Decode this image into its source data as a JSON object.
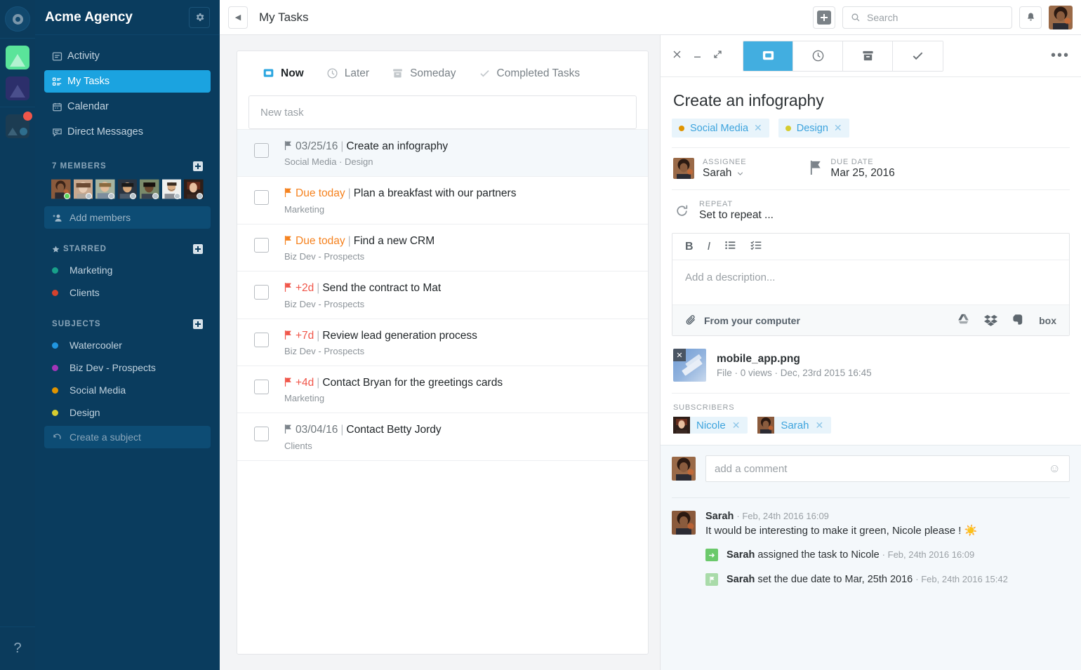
{
  "rail": {
    "logo_icon": "circle-logo-icon",
    "apps": [
      {
        "name": "workspace-green",
        "icon": "triangle-icon"
      },
      {
        "name": "workspace-navy",
        "icon": "triangle-icon"
      },
      {
        "name": "workspace-dark",
        "icon": "triangle-circle-icon",
        "badge": true
      }
    ],
    "help_label": "?"
  },
  "sidebar": {
    "title": "Acme Agency",
    "settings_icon": "gear-icon",
    "nav": [
      {
        "label": "Activity",
        "icon": "activity-icon",
        "active": false
      },
      {
        "label": "My Tasks",
        "icon": "tasks-icon",
        "active": true
      },
      {
        "label": "Calendar",
        "icon": "calendar-icon",
        "active": false
      },
      {
        "label": "Direct Messages",
        "icon": "message-icon",
        "active": false
      }
    ],
    "members_header": "7 MEMBERS",
    "members_count": 7,
    "add_members_label": "Add members",
    "starred_header": "STARRED",
    "starred": [
      {
        "label": "Marketing",
        "color": "#18a08a"
      },
      {
        "label": "Clients",
        "color": "#d4422e"
      }
    ],
    "subjects_header": "SUBJECTS",
    "subjects": [
      {
        "label": "Watercooler",
        "color": "#2196e0"
      },
      {
        "label": "Biz Dev - Prospects",
        "color": "#a436b8"
      },
      {
        "label": "Social Media",
        "color": "#e09400"
      },
      {
        "label": "Design",
        "color": "#d6cc30"
      }
    ],
    "create_subject_label": "Create a subject"
  },
  "topbar": {
    "collapse_icon": "chevron-left-icon",
    "page_title": "My Tasks",
    "add_icon": "plus-icon",
    "search_placeholder": "Search",
    "search_value": "",
    "search_icon": "search-icon",
    "bell_icon": "bell-icon",
    "avatar": "user-avatar"
  },
  "list": {
    "tabs": [
      {
        "label": "Now",
        "icon": "inbox-icon",
        "active": true
      },
      {
        "label": "Later",
        "icon": "clock-icon",
        "active": false
      },
      {
        "label": "Someday",
        "icon": "archive-icon",
        "active": false
      },
      {
        "label": "Completed Tasks",
        "icon": "check-icon",
        "active": false
      }
    ],
    "new_task_placeholder": "New task",
    "tasks": [
      {
        "date": "03/25/16",
        "date_style": "gray",
        "title": "Create an infography",
        "subject": "Social Media · Design",
        "selected": true
      },
      {
        "date": "Due today",
        "date_style": "orange",
        "title": "Plan a breakfast with our partners",
        "subject": "Marketing",
        "selected": false
      },
      {
        "date": "Due today",
        "date_style": "orange",
        "title": "Find a new CRM",
        "subject": "Biz Dev - Prospects",
        "selected": false
      },
      {
        "date": "+2d",
        "date_style": "red",
        "title": "Send the contract to Mat",
        "subject": "Biz Dev - Prospects",
        "selected": false
      },
      {
        "date": "+7d",
        "date_style": "red",
        "title": "Review lead generation process",
        "subject": "Biz Dev - Prospects",
        "selected": false
      },
      {
        "date": "+4d",
        "date_style": "red",
        "title": "Contact Bryan for the greetings cards",
        "subject": "Marketing",
        "selected": false
      },
      {
        "date": "03/04/16",
        "date_style": "gray",
        "title": "Contact Betty Jordy",
        "subject": "Clients",
        "selected": false
      }
    ],
    "separator": "|"
  },
  "panel": {
    "close_icon": "close-icon",
    "minimize_icon": "minimize-icon",
    "expand_icon": "expand-icon",
    "more_icon": "kebab-menu-icon",
    "segments": [
      {
        "name": "detail-tab",
        "icon": "inbox-icon",
        "active": true
      },
      {
        "name": "later-tab",
        "icon": "clock-icon",
        "active": false
      },
      {
        "name": "archive-tab",
        "icon": "archive-icon",
        "active": false
      },
      {
        "name": "complete-tab",
        "icon": "check-icon",
        "active": false
      }
    ],
    "task_title": "Create an infography",
    "tags": [
      {
        "label": "Social Media",
        "color": "#e09400"
      },
      {
        "label": "Design",
        "color": "#d6cc30"
      }
    ],
    "assignee_label": "ASSIGNEE",
    "assignee_name": "Sarah",
    "due_label": "DUE DATE",
    "due_value": "Mar 25, 2016",
    "repeat_label": "REPEAT",
    "repeat_value": "Set to repeat ...",
    "editor": {
      "bold": "B",
      "italic": "I",
      "bullet_icon": "bullet-list-icon",
      "checklist_icon": "checklist-icon",
      "placeholder": "Add a description...",
      "upload_label": "From your computer",
      "upload_icon": "paperclip-icon",
      "services": [
        "google-drive-icon",
        "dropbox-icon",
        "evernote-icon",
        "box-icon"
      ],
      "box_label": "box"
    },
    "file": {
      "name": "mobile_app.png",
      "meta": "File · 0 views · Dec, 23rd 2015 16:45",
      "remove_icon": "close-icon"
    },
    "subscribers_label": "SUBSCRIBERS",
    "subscribers": [
      "Nicole",
      "Sarah"
    ],
    "comment_placeholder": "add a comment",
    "emoji_icon": "smiley-icon",
    "comments": [
      {
        "author": "Sarah",
        "time": "Feb, 24th 2016 16:09",
        "text": "It would be interesting to make it green, Nicole please ! ☀️"
      }
    ],
    "events": [
      {
        "actor": "Sarah",
        "text": "assigned the task to Nicole",
        "time": "Feb, 24th 2016 16:09",
        "icon": "assign-icon",
        "icon_style": "green"
      },
      {
        "actor": "Sarah",
        "text": "set the due date to Mar, 25th 2016",
        "time": "Feb, 24th 2016 15:42",
        "icon": "flag-icon",
        "icon_style": "lt"
      }
    ],
    "separator_dot": "·"
  }
}
